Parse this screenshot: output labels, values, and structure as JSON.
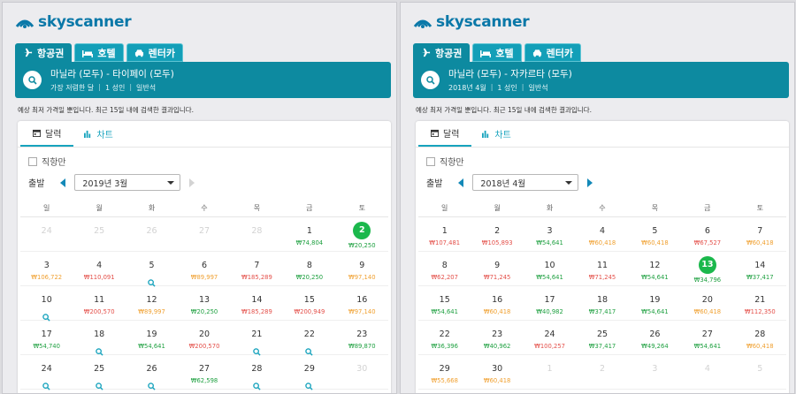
{
  "colors": {
    "brand": "#0a78a8",
    "header": "#0d8aa0",
    "accent": "#17a3bd",
    "low": "#1ea040",
    "mid": "#f0a030",
    "high": "#e4504a",
    "selected": "#1bb84c"
  },
  "weekdays": [
    "일",
    "월",
    "화",
    "수",
    "목",
    "금",
    "토"
  ],
  "panels": [
    {
      "logo": "skyscanner",
      "tabs": [
        {
          "label": "항공권",
          "icon": "plane-icon",
          "active": true
        },
        {
          "label": "호텔",
          "icon": "bed-icon",
          "active": false
        },
        {
          "label": "렌터카",
          "icon": "car-icon",
          "active": false
        }
      ],
      "route": "마닐라 (모두) - 타이페이 (모두)",
      "meta": [
        "가장 저렴한 달",
        "1 성인",
        "일반석"
      ],
      "notice": "예상 최저 가격일 뿐입니다. 최근 15일 내에 검색한 결과입니다.",
      "calendar_tab": "달력",
      "chart_tab": "차트",
      "direct_label": "직항만",
      "depart_label": "출발",
      "month": "2019년 3월",
      "next_disabled": true,
      "days": [
        {
          "d": "24",
          "dim": true
        },
        {
          "d": "25",
          "dim": true
        },
        {
          "d": "26",
          "dim": true
        },
        {
          "d": "27",
          "dim": true
        },
        {
          "d": "28",
          "dim": true
        },
        {
          "d": "1",
          "p": "₩74,804",
          "c": "g"
        },
        {
          "d": "2",
          "p": "₩20,250",
          "c": "g",
          "sel": true
        },
        {
          "d": "3",
          "p": "₩106,722",
          "c": "o"
        },
        {
          "d": "4",
          "p": "₩110,091",
          "c": "r"
        },
        {
          "d": "5",
          "mag": true
        },
        {
          "d": "6",
          "p": "₩89,997",
          "c": "o"
        },
        {
          "d": "7",
          "p": "₩185,289",
          "c": "r"
        },
        {
          "d": "8",
          "p": "₩20,250",
          "c": "g"
        },
        {
          "d": "9",
          "p": "₩97,140",
          "c": "o"
        },
        {
          "d": "10",
          "mag": true
        },
        {
          "d": "11",
          "p": "₩200,570",
          "c": "r"
        },
        {
          "d": "12",
          "p": "₩89,997",
          "c": "o"
        },
        {
          "d": "13",
          "p": "₩20,250",
          "c": "g"
        },
        {
          "d": "14",
          "p": "₩185,289",
          "c": "r"
        },
        {
          "d": "15",
          "p": "₩200,949",
          "c": "r"
        },
        {
          "d": "16",
          "p": "₩97,140",
          "c": "o"
        },
        {
          "d": "17",
          "p": "₩54,740",
          "c": "g"
        },
        {
          "d": "18",
          "mag": true
        },
        {
          "d": "19",
          "p": "₩54,641",
          "c": "g"
        },
        {
          "d": "20",
          "p": "₩200,570",
          "c": "r"
        },
        {
          "d": "21",
          "mag": true
        },
        {
          "d": "22",
          "mag": true
        },
        {
          "d": "23",
          "p": "₩89,870",
          "c": "g"
        },
        {
          "d": "24",
          "mag": true
        },
        {
          "d": "25",
          "mag": true
        },
        {
          "d": "26",
          "mag": true
        },
        {
          "d": "27",
          "p": "₩62,598",
          "c": "g"
        },
        {
          "d": "28",
          "mag": true
        },
        {
          "d": "29",
          "mag": true
        },
        {
          "d": "30",
          "dim": true
        }
      ]
    },
    {
      "logo": "skyscanner",
      "tabs": [
        {
          "label": "항공권",
          "icon": "plane-icon",
          "active": true
        },
        {
          "label": "호텔",
          "icon": "bed-icon",
          "active": false
        },
        {
          "label": "렌터카",
          "icon": "car-icon",
          "active": false
        }
      ],
      "route": "마닐라 (모두) - 자카르타 (모두)",
      "meta": [
        "2018년 4월",
        "1 성인",
        "일반석"
      ],
      "notice": "예상 최저 가격일 뿐입니다. 최근 15일 내에 검색한 결과입니다.",
      "calendar_tab": "달력",
      "chart_tab": "차트",
      "direct_label": "직항만",
      "depart_label": "출발",
      "month": "2018년 4월",
      "next_disabled": false,
      "days": [
        {
          "d": "1",
          "p": "₩107,481",
          "c": "r"
        },
        {
          "d": "2",
          "p": "₩105,893",
          "c": "r"
        },
        {
          "d": "3",
          "p": "₩54,641",
          "c": "g"
        },
        {
          "d": "4",
          "p": "₩60,418",
          "c": "o"
        },
        {
          "d": "5",
          "p": "₩60,418",
          "c": "o"
        },
        {
          "d": "6",
          "p": "₩67,527",
          "c": "r"
        },
        {
          "d": "7",
          "p": "₩60,418",
          "c": "o"
        },
        {
          "d": "8",
          "p": "₩62,207",
          "c": "r"
        },
        {
          "d": "9",
          "p": "₩71,245",
          "c": "r"
        },
        {
          "d": "10",
          "p": "₩54,641",
          "c": "g"
        },
        {
          "d": "11",
          "p": "₩71,245",
          "c": "r"
        },
        {
          "d": "12",
          "p": "₩54,641",
          "c": "g"
        },
        {
          "d": "13",
          "p": "₩34,796",
          "c": "g",
          "sel": true
        },
        {
          "d": "14",
          "p": "₩37,417",
          "c": "g"
        },
        {
          "d": "15",
          "p": "₩54,641",
          "c": "g"
        },
        {
          "d": "16",
          "p": "₩60,418",
          "c": "o"
        },
        {
          "d": "17",
          "p": "₩40,982",
          "c": "g"
        },
        {
          "d": "18",
          "p": "₩37,417",
          "c": "g"
        },
        {
          "d": "19",
          "p": "₩54,641",
          "c": "g"
        },
        {
          "d": "20",
          "p": "₩60,418",
          "c": "o"
        },
        {
          "d": "21",
          "p": "₩112,350",
          "c": "r"
        },
        {
          "d": "22",
          "p": "₩36,396",
          "c": "g"
        },
        {
          "d": "23",
          "p": "₩40,962",
          "c": "g"
        },
        {
          "d": "24",
          "p": "₩100,257",
          "c": "r"
        },
        {
          "d": "25",
          "p": "₩37,417",
          "c": "g"
        },
        {
          "d": "26",
          "p": "₩49,264",
          "c": "g"
        },
        {
          "d": "27",
          "p": "₩54,641",
          "c": "g"
        },
        {
          "d": "28",
          "p": "₩60,418",
          "c": "o"
        },
        {
          "d": "29",
          "p": "₩55,668",
          "c": "o"
        },
        {
          "d": "30",
          "p": "₩60,418",
          "c": "o"
        },
        {
          "d": "1",
          "dim": true
        },
        {
          "d": "2",
          "dim": true
        },
        {
          "d": "3",
          "dim": true
        },
        {
          "d": "4",
          "dim": true
        },
        {
          "d": "5",
          "dim": true
        }
      ]
    }
  ]
}
